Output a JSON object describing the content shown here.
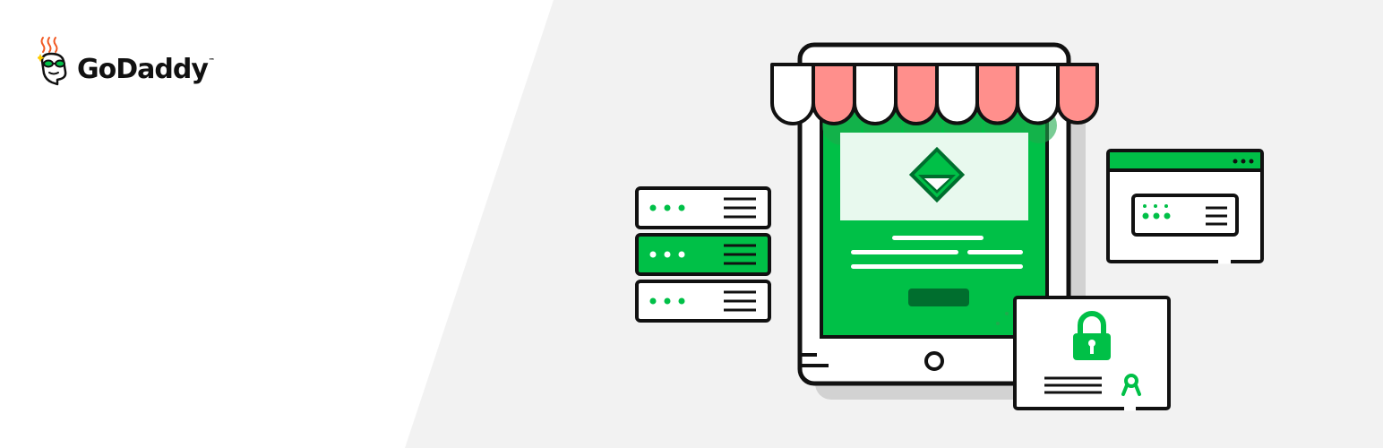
{
  "brand": {
    "name": "GoDaddy",
    "trademark": "™",
    "logo_icon": "buddy-mascot-icon"
  },
  "colors": {
    "background_left": "#ffffff",
    "background_right": "#f2f2f2",
    "outline": "#111111",
    "green": "#00c047",
    "green_dark": "#006e2e",
    "green_light": "#e8f9ee",
    "awning_red": "#ff8f8c",
    "awning_white": "#ffffff",
    "shadow": "#d2d2d2",
    "mascot_orange": "#f15a24"
  },
  "illustration": {
    "tablet": "storefront-tablet-illustration",
    "servers": "server-rack-illustration",
    "browser": "browser-window-illustration",
    "certificate": "ssl-certificate-illustration"
  }
}
